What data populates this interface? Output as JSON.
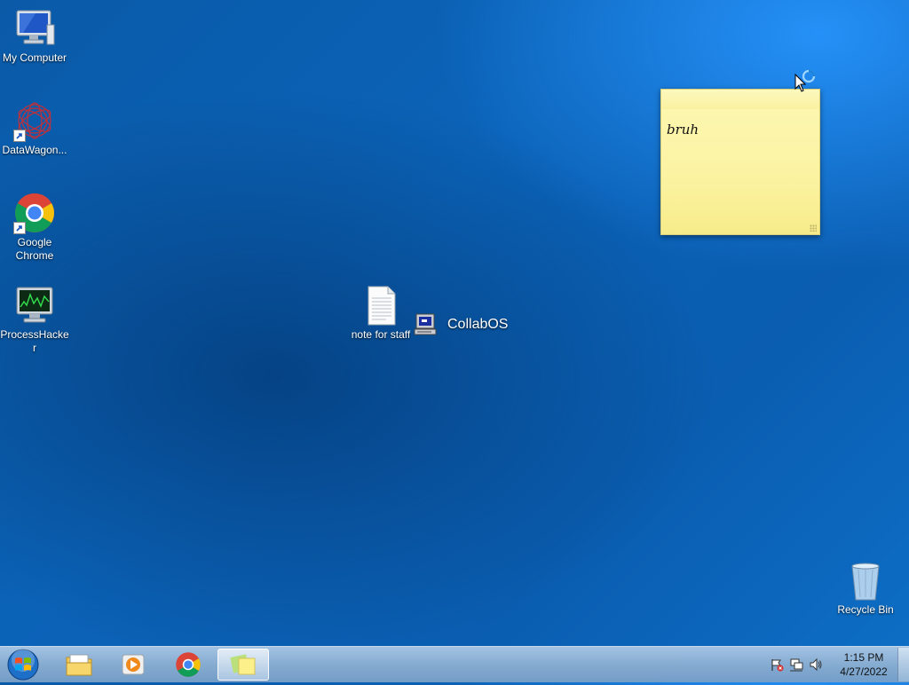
{
  "desktop": {
    "icons": [
      {
        "label": "My Computer",
        "icon": "computer-icon"
      },
      {
        "label": "DataWagon...",
        "icon": "datawagon-icon"
      },
      {
        "label": "Google Chrome",
        "icon": "chrome-icon"
      },
      {
        "label": "ProcessHacker",
        "icon": "processhacker-icon"
      },
      {
        "label": "note for staff",
        "icon": "text-file-icon"
      },
      {
        "label": "Recycle Bin",
        "icon": "recycle-bin-icon"
      }
    ],
    "collab_label": "CollabOS"
  },
  "sticky_note": {
    "text": "bruh"
  },
  "taskbar": {
    "pinned": [
      {
        "name": "file-explorer",
        "icon": "folder-icon"
      },
      {
        "name": "media-player",
        "icon": "media-player-icon"
      },
      {
        "name": "chrome",
        "icon": "chrome-icon"
      },
      {
        "name": "sticky-notes",
        "icon": "sticky-notes-icon",
        "active": true
      }
    ],
    "clock": {
      "time": "1:15 PM",
      "date": "4/27/2022"
    }
  },
  "colors": {
    "desktop_blue": "#0b63b8",
    "sticky_yellow": "#fbf3a2",
    "chrome_red": "#db4437",
    "chrome_yellow": "#f4c20d",
    "chrome_green": "#0f9d58",
    "chrome_blue": "#4285f4"
  }
}
